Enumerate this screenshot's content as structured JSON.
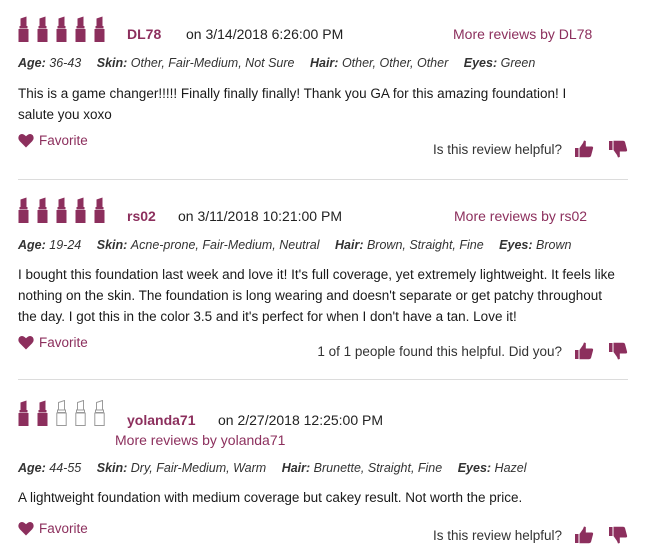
{
  "colors": {
    "accent": "#8c2f5d",
    "star_filled": "#8c2f5d",
    "star_empty": "#9a9a9a"
  },
  "labels": {
    "age": "Age:",
    "skin": "Skin:",
    "hair": "Hair:",
    "eyes": "Eyes:",
    "favorite": "Favorite"
  },
  "reviews": [
    {
      "rating": 5,
      "username": "DL78",
      "date": "on 3/14/2018 6:26:00 PM",
      "more_reviews": "More reviews by DL78",
      "age": "36-43",
      "skin": "Other, Fair-Medium, Not Sure",
      "hair": "Other, Other, Other",
      "eyes": "Green",
      "text": "This is a game changer!!!!! Finally finally finally! Thank you GA for this amazing foundation! I salute you xoxo",
      "helpful": "Is this review helpful?"
    },
    {
      "rating": 5,
      "username": "rs02",
      "date": "on 3/11/2018 10:21:00 PM",
      "more_reviews": "More reviews by rs02",
      "age": "19-24",
      "skin": "Acne-prone, Fair-Medium, Neutral",
      "hair": "Brown, Straight, Fine",
      "eyes": "Brown",
      "text": "I bought this foundation last week and love it! It's full coverage, yet extremely lightweight. It feels like nothing on the skin. The foundation is long wearing and doesn't separate or get patchy throughout the day. I got this in the color 3.5 and it's perfect for when I don't have a tan. Love it!",
      "helpful": "1 of 1 people found this helpful. Did you?"
    },
    {
      "rating": 2,
      "username": "yolanda71",
      "date": "on 2/27/2018 12:25:00 PM",
      "more_reviews": "More reviews by yolanda71",
      "age": "44-55",
      "skin": "Dry, Fair-Medium, Warm",
      "hair": "Brunette, Straight, Fine",
      "eyes": "Hazel",
      "text": "A lightweight foundation with medium coverage but cakey result. Not worth the price.",
      "helpful": "Is this review helpful?"
    }
  ]
}
